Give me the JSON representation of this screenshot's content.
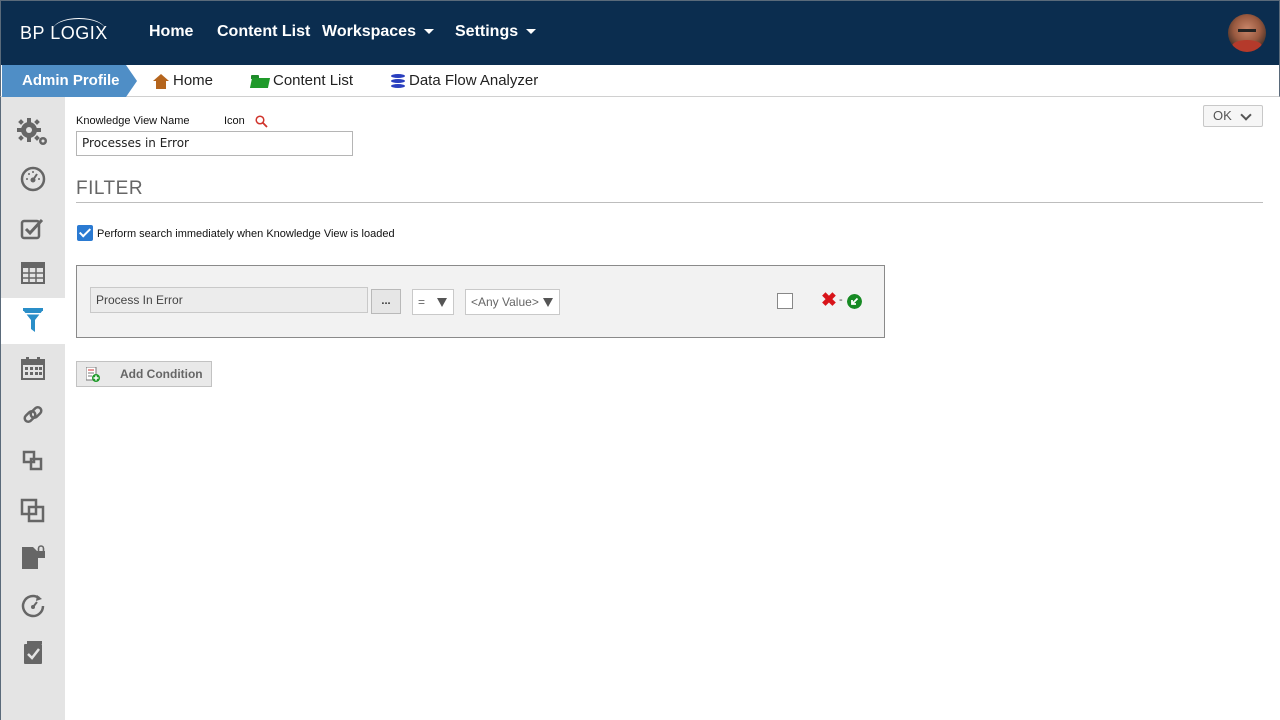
{
  "app": {
    "logo_text": "BP LOGIX"
  },
  "topnav": {
    "items": [
      {
        "label": "Home"
      },
      {
        "label": "Content List"
      },
      {
        "label": "Workspaces",
        "has_dropdown": true
      },
      {
        "label": "Settings",
        "has_dropdown": true
      }
    ]
  },
  "breadcrumb": {
    "profile": "Admin Profile",
    "items": [
      {
        "label": "Home",
        "icon": "home-icon"
      },
      {
        "label": "Content List",
        "icon": "folder-icon"
      },
      {
        "label": "Data Flow Analyzer",
        "icon": "database-icon"
      }
    ]
  },
  "sidebar": {
    "items": [
      {
        "icon": "gears-icon"
      },
      {
        "icon": "dashboard-gauge-icon"
      },
      {
        "icon": "checkbox-edit-icon"
      },
      {
        "icon": "table-icon"
      },
      {
        "icon": "filter-icon",
        "active": true
      },
      {
        "icon": "calendar-icon"
      },
      {
        "icon": "link-icon"
      },
      {
        "icon": "small-copy-icon"
      },
      {
        "icon": "copy-icon"
      },
      {
        "icon": "locked-document-icon"
      },
      {
        "icon": "refresh-gauge-icon"
      },
      {
        "icon": "checked-document-icon"
      }
    ]
  },
  "form": {
    "kv_name_label": "Knowledge View Name",
    "icon_label": "Icon",
    "kv_name_value": "Processes in Error",
    "ok_label": "OK",
    "filter_heading": "FILTER",
    "perform_search_label": "Perform search immediately when Knowledge View is loaded",
    "perform_search_checked": true
  },
  "condition": {
    "field_value": "Process In Error",
    "browse_label": "...",
    "operator_value": "=",
    "value_placeholder": "<Any Value>",
    "negate_checked": false,
    "delete_symbol": "✖",
    "separator": "-"
  },
  "add_condition": {
    "label": "Add Condition"
  },
  "colors": {
    "topbar": "#0b2d4f",
    "profile_tab": "#4f8ec6",
    "checkbox_blue": "#2a7ad2",
    "delete_red": "#d8141a",
    "go_green": "#178a24"
  }
}
